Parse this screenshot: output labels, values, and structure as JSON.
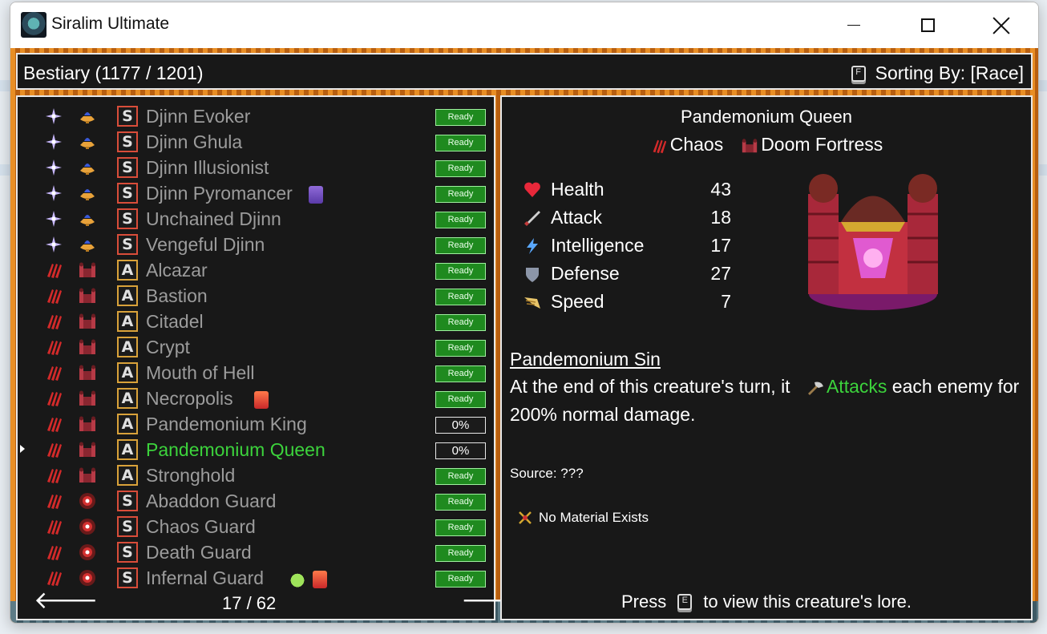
{
  "window": {
    "title": "Siralim Ultimate"
  },
  "header": {
    "title": "Bestiary (1177 / 1201)",
    "sort_key": "F",
    "sort_label": "Sorting By: [Race]"
  },
  "list": {
    "rows": [
      {
        "name": "Djinn Evoker",
        "astral": "sparkle-icon",
        "race": "djinn-lamp-icon",
        "class": "S",
        "tags": [],
        "status": "Ready",
        "selected": false
      },
      {
        "name": "Djinn Ghula",
        "astral": "sparkle-icon",
        "race": "djinn-lamp-icon",
        "class": "S",
        "tags": [],
        "status": "Ready",
        "selected": false
      },
      {
        "name": "Djinn Illusionist",
        "astral": "sparkle-icon",
        "race": "djinn-lamp-icon",
        "class": "S",
        "tags": [],
        "status": "Ready",
        "selected": false
      },
      {
        "name": "Djinn Pyromancer",
        "astral": "sparkle-icon",
        "race": "djinn-lamp-icon",
        "class": "S",
        "tags": [
          "purple"
        ],
        "status": "Ready",
        "selected": false
      },
      {
        "name": "Unchained Djinn",
        "astral": "sparkle-icon",
        "race": "djinn-lamp-icon",
        "class": "S",
        "tags": [],
        "status": "Ready",
        "selected": false
      },
      {
        "name": "Vengeful Djinn",
        "astral": "sparkle-icon",
        "race": "djinn-lamp-icon",
        "class": "S",
        "tags": [],
        "status": "Ready",
        "selected": false
      },
      {
        "name": "Alcazar",
        "astral": "chaos-claw-icon",
        "race": "fortress-icon",
        "class": "A",
        "tags": [],
        "status": "Ready",
        "selected": false
      },
      {
        "name": "Bastion",
        "astral": "chaos-claw-icon",
        "race": "fortress-icon",
        "class": "A",
        "tags": [],
        "status": "Ready",
        "selected": false
      },
      {
        "name": "Citadel",
        "astral": "chaos-claw-icon",
        "race": "fortress-icon",
        "class": "A",
        "tags": [],
        "status": "Ready",
        "selected": false
      },
      {
        "name": "Crypt",
        "astral": "chaos-claw-icon",
        "race": "fortress-icon",
        "class": "A",
        "tags": [],
        "status": "Ready",
        "selected": false
      },
      {
        "name": "Mouth of Hell",
        "astral": "chaos-claw-icon",
        "race": "fortress-icon",
        "class": "A",
        "tags": [],
        "status": "Ready",
        "selected": false
      },
      {
        "name": "Necropolis",
        "astral": "chaos-claw-icon",
        "race": "fortress-icon",
        "class": "A",
        "tags": [
          "red"
        ],
        "status": "Ready",
        "selected": false
      },
      {
        "name": "Pandemonium King",
        "astral": "chaos-claw-icon",
        "race": "fortress-icon",
        "class": "A",
        "tags": [],
        "status": "0%",
        "selected": false
      },
      {
        "name": "Pandemonium Queen",
        "astral": "chaos-claw-icon",
        "race": "fortress-icon",
        "class": "A",
        "tags": [],
        "status": "0%",
        "selected": true
      },
      {
        "name": "Stronghold",
        "astral": "chaos-claw-icon",
        "race": "fortress-icon",
        "class": "A",
        "tags": [],
        "status": "Ready",
        "selected": false
      },
      {
        "name": "Abaddon Guard",
        "astral": "chaos-claw-icon",
        "race": "guard-shield-icon",
        "class": "S",
        "tags": [],
        "status": "Ready",
        "selected": false
      },
      {
        "name": "Chaos Guard",
        "astral": "chaos-claw-icon",
        "race": "guard-shield-icon",
        "class": "S",
        "tags": [],
        "status": "Ready",
        "selected": false
      },
      {
        "name": "Death Guard",
        "astral": "chaos-claw-icon",
        "race": "guard-shield-icon",
        "class": "S",
        "tags": [],
        "status": "Ready",
        "selected": false
      },
      {
        "name": "Infernal Guard",
        "astral": "chaos-claw-icon",
        "race": "guard-shield-icon",
        "class": "S",
        "tags": [
          "green",
          "red"
        ],
        "status": "Ready",
        "selected": false
      }
    ],
    "pager": "17 / 62",
    "prev_glyph": "🡐",
    "next_glyph": "🡒"
  },
  "detail": {
    "name": "Pandemonium Queen",
    "klass": "Chaos",
    "race": "Doom Fortress",
    "stats": [
      {
        "label": "Health",
        "value": "43",
        "icon": "heart-icon",
        "color": "#e8283a"
      },
      {
        "label": "Attack",
        "value": "18",
        "icon": "sword-icon",
        "color": "#cfcfcf"
      },
      {
        "label": "Intelligence",
        "value": "17",
        "icon": "lightning-icon",
        "color": "#5aa8ff"
      },
      {
        "label": "Defense",
        "value": "27",
        "icon": "shield-icon",
        "color": "#8c96a8"
      },
      {
        "label": "Speed",
        "value": "7",
        "icon": "wing-icon",
        "color": "#e8c56a"
      }
    ],
    "ability": {
      "name": "Pandemonium Sin",
      "desc_before": "At the end of this creature's turn, it",
      "desc_highlight": "Attacks",
      "desc_after": "each enemy for 200% normal damage."
    },
    "source": "Source: ???",
    "material": "No Material Exists",
    "lore_press": "Press",
    "lore_key": "E",
    "lore_after": "to view this creature's lore."
  },
  "colors": {
    "highlight": "#3cd33c",
    "ready_bg": "#1f8a1f",
    "panel_bg": "#181818"
  }
}
